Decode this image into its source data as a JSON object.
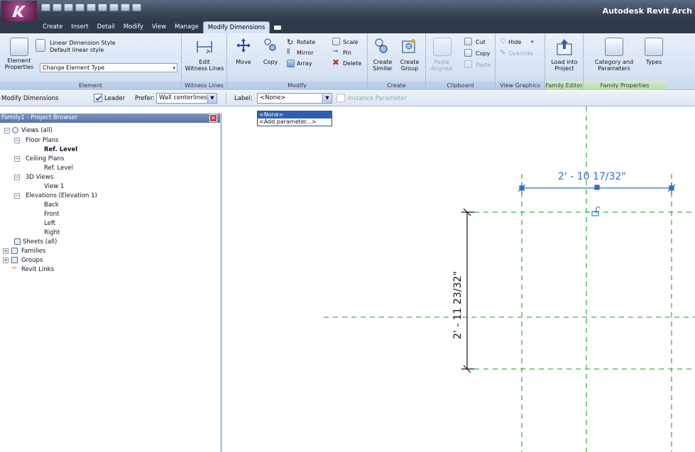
{
  "app": {
    "title": "Autodesk Revit Arch"
  },
  "tabs": [
    {
      "label": "Create"
    },
    {
      "label": "Insert"
    },
    {
      "label": "Detail"
    },
    {
      "label": "Modify"
    },
    {
      "label": "View"
    },
    {
      "label": "Manage"
    },
    {
      "label": "Modify Dimensions"
    }
  ],
  "ribbon": {
    "element": {
      "style_line1": "Linear Dimension Style",
      "style_line2": "Default linear style",
      "props_line1": "Element",
      "props_line2": "Properties",
      "change_type": "Change Element Type",
      "label": "Element"
    },
    "witness": {
      "edit_line1": "Edit",
      "edit_line2": "Witness Lines",
      "label": "Witness Lines"
    },
    "modify": {
      "move": "Move",
      "copy": "Copy",
      "rotate": "Rotate",
      "mirror": "Mirror",
      "array": "Array",
      "scale": "Scale",
      "pin": "Pin",
      "delete": "Delete",
      "label": "Modify"
    },
    "create": {
      "similar_line1": "Create",
      "similar_line2": "Similar",
      "group_line1": "Create",
      "group_line2": "Group",
      "label": "Create"
    },
    "clipboard": {
      "paste_line1": "Paste",
      "paste_line2": "Aligned",
      "cut": "Cut",
      "copy": "Copy",
      "paste": "Paste",
      "label": "Clipboard"
    },
    "viewgraphics": {
      "hide": "Hide",
      "override": "Override",
      "label": "View Graphics"
    },
    "familyeditor": {
      "load_line1": "Load into",
      "load_line2": "Project",
      "label": "Family Editor"
    },
    "familyprops": {
      "cat_line1": "Category and",
      "cat_line2": "Parameters",
      "types": "Types",
      "label": "Family Properties"
    }
  },
  "options": {
    "context": "Modify Dimensions",
    "leader": "Leader",
    "leader_checked": true,
    "prefer_label": "Prefer:",
    "prefer_value": "Wall centerlines",
    "label_label": "Label:",
    "label_value": "<None>",
    "instance_param": "Instance Parameter"
  },
  "label_dropdown": {
    "options": [
      "<None>",
      "<Add parameter...>"
    ],
    "selected": "<None>"
  },
  "browser": {
    "title": "Family1 - Project Browser",
    "nodes": [
      {
        "label": "Views (all)"
      },
      {
        "label": "Floor Plans"
      },
      {
        "label": "Ref. Level"
      },
      {
        "label": "Ceiling Plans"
      },
      {
        "label": "Ref. Level"
      },
      {
        "label": "3D Views"
      },
      {
        "label": "View 1"
      },
      {
        "label": "Elevations (Elevation 1)"
      },
      {
        "label": "Back"
      },
      {
        "label": "Front"
      },
      {
        "label": "Left"
      },
      {
        "label": "Right"
      },
      {
        "label": "Sheets (all)"
      },
      {
        "label": "Families"
      },
      {
        "label": "Groups"
      },
      {
        "label": "Revit Links"
      }
    ]
  },
  "drawing": {
    "horizontal_dim": "2' - 10 17/32\"",
    "vertical_dim": "2' - 11 23/32\"",
    "ref_color": "#3fb43f",
    "dim_color": "#2f6fc8"
  }
}
